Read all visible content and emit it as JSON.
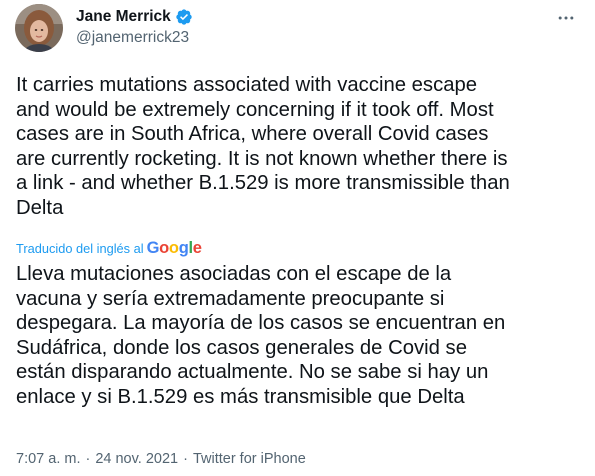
{
  "author": {
    "display_name": "Jane Merrick",
    "handle": "@janemerrick23",
    "verified": true
  },
  "tweet": {
    "text": "It carries mutations associated with vaccine escape\nand would be extremely concerning if it took off. Most\ncases are in South Africa, where overall Covid cases\nare currently rocketing. It is not known whether there is\na link - and whether B.1.529 is more transmissible than\nDelta",
    "translation_label": "Traducido del inglés al",
    "translation_provider": [
      "G",
      "o",
      "o",
      "g",
      "l",
      "e"
    ],
    "translated_text": "Lleva mutaciones asociadas con el escape de la\nvacuna y sería extremadamente preocupante si\ndespegara. La mayoría de los casos se encuentran en\nSudáfrica, donde los casos generales de Covid se\nestán disparando actualmente. No se sabe si hay un\nenlace y si B.1.529 es más transmisible que Delta"
  },
  "meta": {
    "time": "7:07 a. m.",
    "separator": "·",
    "date": "24 nov. 2021",
    "source": "Twitter for iPhone"
  },
  "colors": {
    "text": "#0f1419",
    "secondary": "#536471",
    "link": "#1d9bf0",
    "verified": "#1d9bf0"
  },
  "icons": {
    "verified": "verified-badge-icon",
    "more": "more-dots-icon"
  }
}
